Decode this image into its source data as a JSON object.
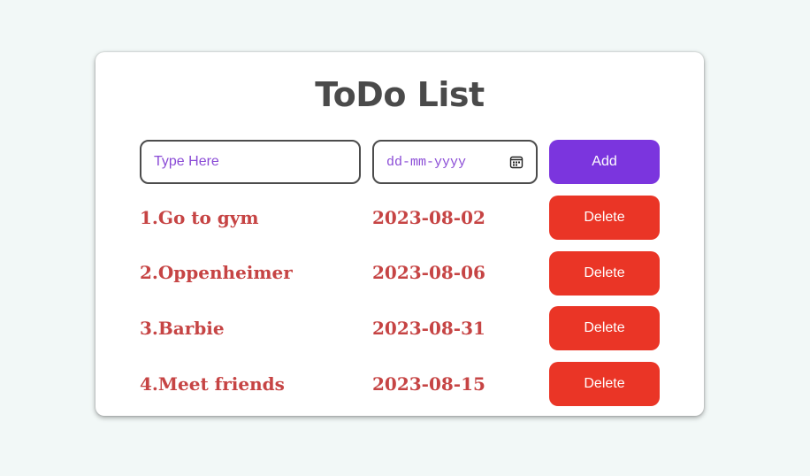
{
  "app": {
    "title": "ToDo List"
  },
  "form": {
    "task_placeholder": "Type Here",
    "task_value": "",
    "date_placeholder": "dd-mm-yyyy",
    "add_label": "Add"
  },
  "todos": [
    {
      "name": "1.Go to gym",
      "date": "2023-08-02",
      "delete_label": "Delete"
    },
    {
      "name": "2.Oppenheimer",
      "date": "2023-08-06",
      "delete_label": "Delete"
    },
    {
      "name": "3.Barbie",
      "date": "2023-08-31",
      "delete_label": "Delete"
    },
    {
      "name": "4.Meet friends",
      "date": "2023-08-15",
      "delete_label": "Delete"
    }
  ],
  "colors": {
    "background": "#f2f8f7",
    "title": "#4a4a4a",
    "placeholder": "#8a4bd6",
    "add_button": "#7b35de",
    "delete_button": "#ea3526",
    "todo_text": "#c64444"
  },
  "icons": {
    "date_picker": "calendar-icon"
  }
}
